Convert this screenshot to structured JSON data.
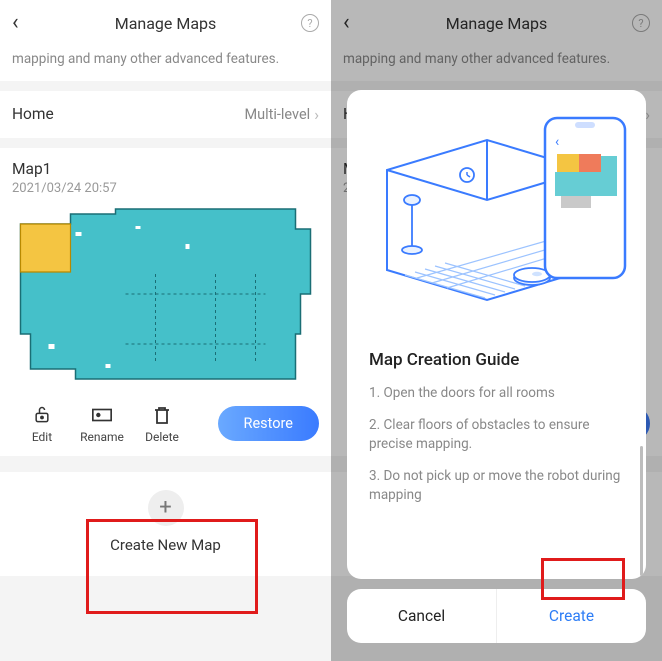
{
  "header": {
    "title": "Manage Maps"
  },
  "notice": "mapping and many other advanced features.",
  "home_row": {
    "label": "Home",
    "value": "Multi-level"
  },
  "map": {
    "name": "Map1",
    "timestamp": "2021/03/24 20:57",
    "actions": {
      "edit": "Edit",
      "rename": "Rename",
      "delete": "Delete",
      "restore": "Restore"
    }
  },
  "create": {
    "label": "Create New Map"
  },
  "guide": {
    "title": "Map Creation Guide",
    "steps": [
      "1. Open the doors for all rooms",
      "2. Clear floors of obstacles to ensure precise mapping.",
      "3. Do not pick up or move the robot during mapping"
    ],
    "cancel": "Cancel",
    "create": "Create"
  }
}
